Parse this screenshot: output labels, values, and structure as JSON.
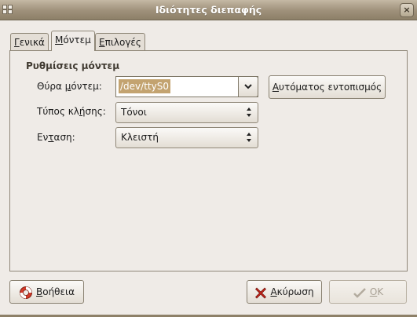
{
  "window": {
    "title": "Ιδιότητες διεπαφής",
    "close_glyph": "×"
  },
  "tabs": [
    {
      "mnemonic": "Γ",
      "rest": "ενικά",
      "active": false
    },
    {
      "mnemonic": "Μ",
      "rest": "όντεμ",
      "active": true
    },
    {
      "mnemonic": "Ε",
      "rest": "πιλογές",
      "active": false
    }
  ],
  "modem_settings": {
    "section_title": "Ρυθμίσεις μόντεμ",
    "port_label": {
      "before": "Θύρα ",
      "mnemonic": "μ",
      "after": "όντεμ:"
    },
    "port_value": "/dev/ttyS0",
    "autodetect_button": {
      "mnemonic": "Α",
      "rest": "υτόματος εντοπισμός"
    },
    "dial_type_label": {
      "before": "Τύπος κλ",
      "mnemonic": "ή",
      "after": "σης:"
    },
    "dial_type_value": "Τόνοι",
    "volume_label": {
      "before": "Εν",
      "mnemonic": "τ",
      "after": "αση:"
    },
    "volume_value": "Κλειστή"
  },
  "footer": {
    "help_button": {
      "mnemonic": "Β",
      "rest": "οήθεια"
    },
    "cancel_button": {
      "mnemonic": "Α",
      "rest": "κύρωση"
    },
    "ok_button": {
      "mnemonic": "O",
      "rest": "K",
      "enabled": false
    }
  },
  "icons": {
    "help": "lifebuoy-icon",
    "cancel": "red-x-icon",
    "ok": "checkmark-icon"
  },
  "colors": {
    "titlebar": "#9e907a",
    "selection": "#c3a370",
    "dialog_bg": "#efebe7"
  }
}
